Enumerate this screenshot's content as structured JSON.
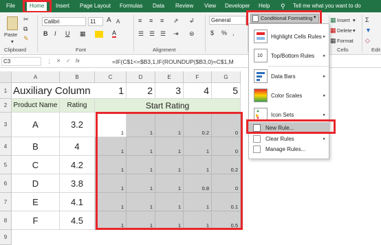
{
  "tabs": [
    "File",
    "Home",
    "Insert",
    "Page Layout",
    "Formulas",
    "Data",
    "Review",
    "View",
    "Developer",
    "Help"
  ],
  "tell_me": "Tell me what you want to do",
  "ribbon": {
    "paste": "Paste",
    "groups": {
      "clipboard": "Clipboard",
      "font": "Font",
      "alignment": "Alignment",
      "cells": "Cells",
      "editing": "Edit"
    },
    "font_name": "Calibri",
    "font_size": "11",
    "font_grow": "A",
    "font_shrink": "A",
    "bold": "B",
    "italic": "I",
    "underline": "U",
    "font_color": "A",
    "number_format": "General",
    "currency": "$",
    "percent": "%",
    "comma": ",",
    "cond_format": "Conditional Formatting",
    "insert": "Insert",
    "delete": "Delete",
    "format": "Format"
  },
  "formula_bar": {
    "name_box": "C3",
    "fx": "fx",
    "formula": "=IF(C$1<=$B3,1,IF(ROUNDUP($B3,0)=C$1,M"
  },
  "columns": [
    "A",
    "B",
    "C",
    "D",
    "E",
    "F",
    "G"
  ],
  "rows": [
    "1",
    "2",
    "3",
    "4",
    "5",
    "6",
    "7",
    "8",
    "9"
  ],
  "sheet": {
    "a1": "Auxiliary Column",
    "c1": "1",
    "d1": "2",
    "e1": "3",
    "f1": "4",
    "g1": "5",
    "a2": "Product Name",
    "b2": "Rating",
    "c2": "Start Rating",
    "products": [
      {
        "name": "A",
        "rating": "3.2",
        "vals": [
          "1",
          "1",
          "1",
          "0.2",
          "0"
        ]
      },
      {
        "name": "B",
        "rating": "4",
        "vals": [
          "1",
          "1",
          "1",
          "1",
          "0"
        ]
      },
      {
        "name": "C",
        "rating": "4.2",
        "vals": [
          "1",
          "1",
          "1",
          "1",
          "0.2"
        ]
      },
      {
        "name": "D",
        "rating": "3.8",
        "vals": [
          "1",
          "1",
          "1",
          "0.8",
          "0"
        ]
      },
      {
        "name": "E",
        "rating": "4.1",
        "vals": [
          "1",
          "1",
          "1",
          "1",
          "0.1"
        ]
      },
      {
        "name": "F",
        "rating": "4.5",
        "vals": [
          "1",
          "1",
          "1",
          "1",
          "0.5"
        ]
      }
    ]
  },
  "menu": {
    "highlight": "Highlight Cells Rules",
    "topbottom": "Top/Bottom Rules",
    "databars": "Data Bars",
    "colorscales": "Color Scales",
    "iconsets": "Icon Sets",
    "newrule": "New Rule...",
    "clearrules": "Clear Rules",
    "managerules": "Manage Rules...",
    "topbottom_icon": "10"
  },
  "colors": {
    "brand": "#217346",
    "highlight": "#e8262a",
    "selected_fill": "#d0d0d0"
  }
}
